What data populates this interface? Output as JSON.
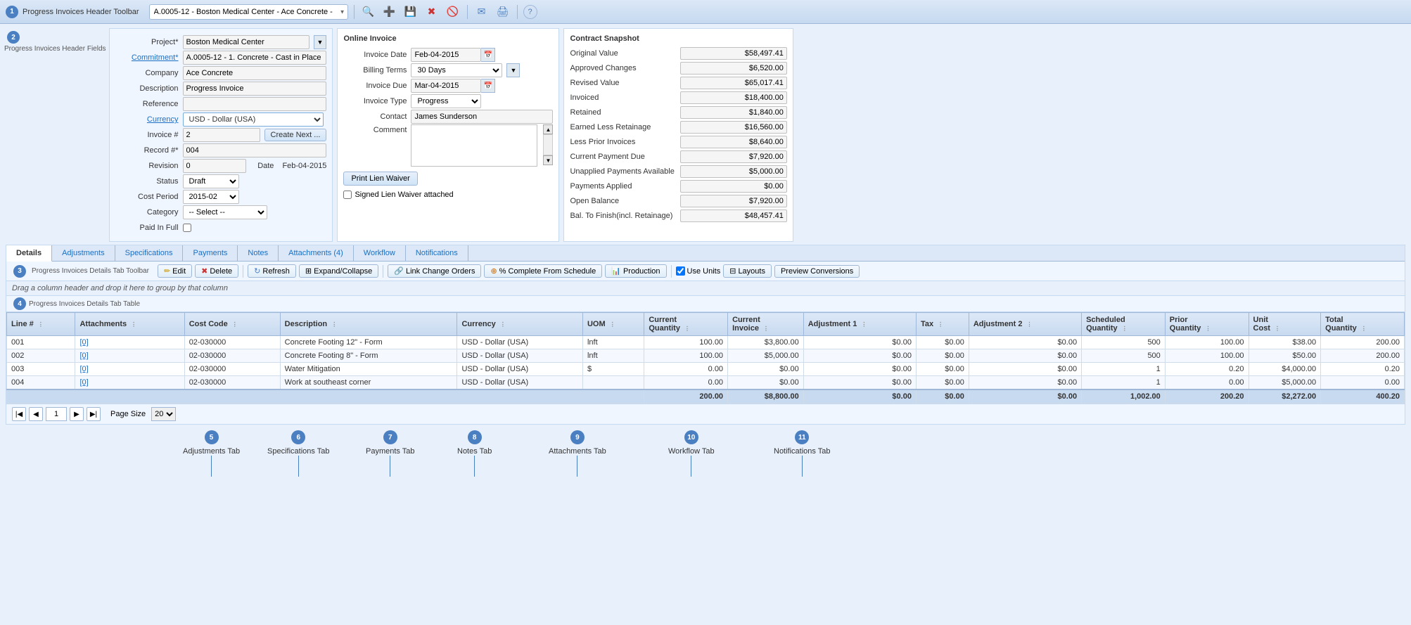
{
  "app": {
    "title": "Progress Invoices Header Toolbar",
    "badge1": "1",
    "badge2": "2",
    "badge3": "3",
    "badge4": "4"
  },
  "toolbar": {
    "dropdown_value": "A.0005-12 - Boston Medical Center - Ace Concrete -",
    "search_icon": "🔍",
    "add_icon": "➕",
    "save_icon": "💾",
    "delete_icon": "✖",
    "cancel_icon": "🚫",
    "email_icon": "✉",
    "print_icon": "🖨",
    "help_icon": "?"
  },
  "header_fields": {
    "project_label": "Project*",
    "project_value": "Boston Medical Center",
    "commitment_label": "Commitment*",
    "commitment_value": "A.0005-12 - 1. Concrete - Cast in Place",
    "company_label": "Company",
    "company_value": "Ace Concrete",
    "description_label": "Description",
    "description_value": "Progress Invoice",
    "reference_label": "Reference",
    "reference_value": "",
    "currency_label": "Currency",
    "currency_value": "USD - Dollar (USA)",
    "invoice_num_label": "Invoice #",
    "invoice_num_value": "2",
    "create_next_label": "Create Next ...",
    "record_num_label": "Record #*",
    "record_num_value": "004",
    "revision_label": "Revision",
    "revision_value": "0",
    "date_label": "Date",
    "date_value": "Feb-04-2015",
    "status_label": "Status",
    "status_value": "Draft",
    "cost_period_label": "Cost Period",
    "cost_period_value": "2015-02",
    "category_label": "Category",
    "category_value": "-- Select --",
    "paid_in_full_label": "Paid In Full"
  },
  "online_invoice": {
    "title": "Online Invoice",
    "invoice_date_label": "Invoice Date",
    "invoice_date_value": "Feb-04-2015",
    "billing_terms_label": "Billing Terms",
    "billing_terms_value": "30 Days",
    "invoice_due_label": "Invoice Due",
    "invoice_due_value": "Mar-04-2015",
    "invoice_type_label": "Invoice Type",
    "invoice_type_value": "Progress",
    "contact_label": "Contact",
    "contact_value": "James Sunderson",
    "comment_label": "Comment",
    "comment_value": "",
    "print_lien_label": "Print Lien Waiver",
    "signed_lien_label": "Signed Lien Waiver attached"
  },
  "contract_snapshot": {
    "title": "Contract Snapshot",
    "rows": [
      {
        "label": "Original Value",
        "value": "$58,497.41"
      },
      {
        "label": "Approved Changes",
        "value": "$6,520.00"
      },
      {
        "label": "Revised Value",
        "value": "$65,017.41"
      },
      {
        "label": "Invoiced",
        "value": "$18,400.00"
      },
      {
        "label": "Retained",
        "value": "$1,840.00"
      },
      {
        "label": "Earned Less Retainage",
        "value": "$16,560.00"
      },
      {
        "label": "Less Prior Invoices",
        "value": "$8,640.00"
      },
      {
        "label": "Current Payment Due",
        "value": "$7,920.00"
      },
      {
        "label": "Unapplied Payments Available",
        "value": "$5,000.00"
      },
      {
        "label": "Payments Applied",
        "value": "$0.00"
      },
      {
        "label": "Open Balance",
        "value": "$7,920.00"
      },
      {
        "label": "Bal. To Finish(incl. Retainage)",
        "value": "$48,457.41"
      }
    ]
  },
  "tabs": {
    "items": [
      {
        "id": "details",
        "label": "Details",
        "active": true
      },
      {
        "id": "adjustments",
        "label": "Adjustments"
      },
      {
        "id": "specifications",
        "label": "Specifications"
      },
      {
        "id": "payments",
        "label": "Payments"
      },
      {
        "id": "notes",
        "label": "Notes"
      },
      {
        "id": "attachments",
        "label": "Attachments (4)"
      },
      {
        "id": "workflow",
        "label": "Workflow"
      },
      {
        "id": "notifications",
        "label": "Notifications"
      }
    ]
  },
  "detail_toolbar": {
    "edit_label": "Edit",
    "delete_label": "Delete",
    "refresh_label": "Refresh",
    "expand_collapse_label": "Expand/Collapse",
    "link_change_orders_label": "Link Change Orders",
    "complete_from_schedule_label": "% Complete From Schedule",
    "production_label": "Production",
    "use_units_label": "Use Units",
    "layouts_label": "Layouts",
    "preview_conversions_label": "Preview Conversions"
  },
  "table": {
    "drag_hint": "Drag a column header and drop it here to group by that column",
    "columns": [
      "Line #",
      "Attachments",
      "Cost Code",
      "Description",
      "Currency",
      "UOM",
      "Current Quantity",
      "Current Invoice",
      "Adjustment 1",
      "Tax",
      "Adjustment 2",
      "Scheduled Quantity",
      "Prior Quantity",
      "Unit Cost",
      "Total Quantity"
    ],
    "rows": [
      {
        "line": "001",
        "attachment": "[0]",
        "cost_code": "02-030000",
        "description": "Concrete Footing 12\" - Form",
        "currency": "USD - Dollar (USA)",
        "uom": "lnft",
        "current_qty": "100.00",
        "current_invoice": "$3,800.00",
        "adj1": "$0.00",
        "tax": "$0.00",
        "adj2": "$0.00",
        "scheduled_qty": "500",
        "prior_qty": "100.00",
        "unit_cost": "$38.00",
        "total_qty": "200.00"
      },
      {
        "line": "002",
        "attachment": "[0]",
        "cost_code": "02-030000",
        "description": "Concrete Footing 8\" - Form",
        "currency": "USD - Dollar (USA)",
        "uom": "lnft",
        "current_qty": "100.00",
        "current_invoice": "$5,000.00",
        "adj1": "$0.00",
        "tax": "$0.00",
        "adj2": "$0.00",
        "scheduled_qty": "500",
        "prior_qty": "100.00",
        "unit_cost": "$50.00",
        "total_qty": "200.00"
      },
      {
        "line": "003",
        "attachment": "[0]",
        "cost_code": "02-030000",
        "description": "Water Mitigation",
        "currency": "USD - Dollar (USA)",
        "uom": "$",
        "current_qty": "0.00",
        "current_invoice": "$0.00",
        "adj1": "$0.00",
        "tax": "$0.00",
        "adj2": "$0.00",
        "scheduled_qty": "1",
        "prior_qty": "0.20",
        "unit_cost": "$4,000.00",
        "total_qty": "0.20"
      },
      {
        "line": "004",
        "attachment": "[0]",
        "cost_code": "02-030000",
        "description": "Work at southeast corner",
        "currency": "USD - Dollar (USA)",
        "uom": "",
        "current_qty": "0.00",
        "current_invoice": "$0.00",
        "adj1": "$0.00",
        "tax": "$0.00",
        "adj2": "$0.00",
        "scheduled_qty": "1",
        "prior_qty": "0.00",
        "unit_cost": "$5,000.00",
        "total_qty": "0.00"
      }
    ],
    "totals": {
      "current_qty": "200.00",
      "current_invoice": "$8,800.00",
      "adj1": "$0.00",
      "tax": "$0.00",
      "adj2": "$0.00",
      "scheduled_qty": "1,002.00",
      "prior_qty": "200.20",
      "unit_cost": "$2,272.00",
      "total_qty": "400.20"
    }
  },
  "pagination": {
    "page_size_label": "Page Size",
    "page_size_value": "20",
    "current_page": "1"
  },
  "annotations": {
    "label1": "Progress Invoices Header Toolbar",
    "num1": "1",
    "label2": "Progress Invoices Header Fields",
    "num2": "2",
    "label3": "Progress Invoices Details Tab Toolbar",
    "num3": "3",
    "label4": "Progress Invoices Details Tab Table",
    "num4": "4",
    "label5": "Adjustments Tab",
    "num5": "5",
    "label6": "Specifications Tab",
    "num6": "6",
    "label7": "Payments Tab",
    "num7": "7",
    "label8": "Notes Tab",
    "num8": "8",
    "label9": "Attachments Tab",
    "num9": "9",
    "label10": "Workflow Tab",
    "num10": "10",
    "label11": "Notifications Tab",
    "num11": "11"
  }
}
